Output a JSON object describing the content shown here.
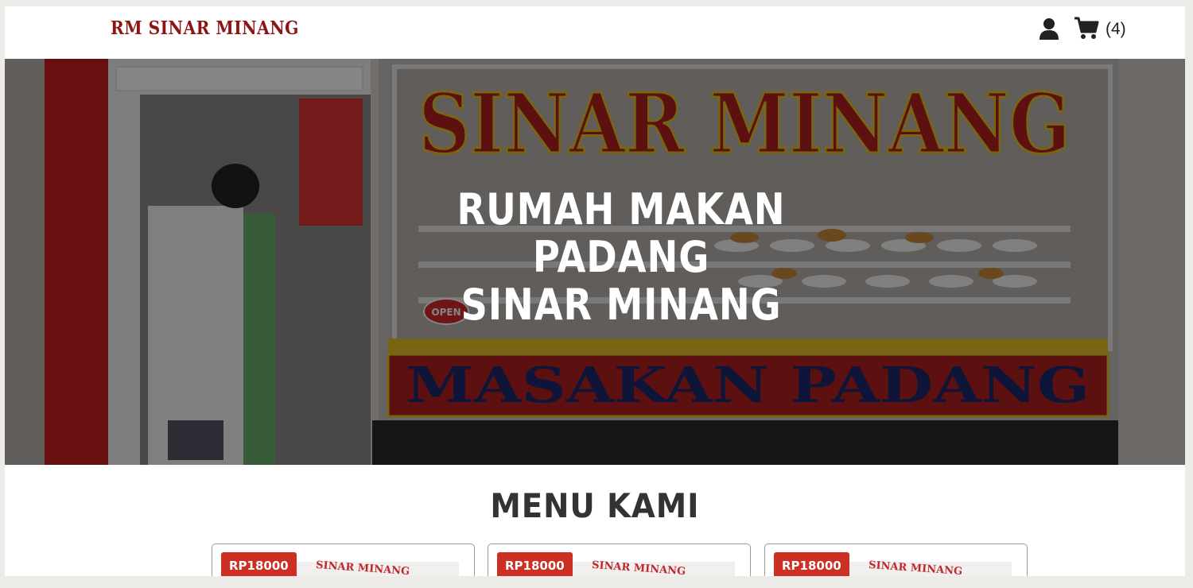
{
  "header": {
    "brand": "RM SINAR MINANG",
    "cart_count": "(4)",
    "icons": [
      "user-icon",
      "cart-icon"
    ]
  },
  "hero": {
    "title_lines": [
      "RUMAH MAKAN",
      "PADANG",
      "SINAR MINANG"
    ],
    "sign_top": "SINAR MINANG",
    "sign_bottom": "MASAKAN PADANG",
    "open_sign": "OPEN"
  },
  "menu": {
    "heading": "MENU KAMI",
    "items": [
      {
        "price": "RP18000",
        "image_logo": "SINAR MINANG"
      },
      {
        "price": "RP18000",
        "image_logo": "SINAR MINANG"
      },
      {
        "price": "RP18000",
        "image_logo": "SINAR MINANG"
      }
    ]
  },
  "colors": {
    "brand": "#8e1414",
    "badge": "#cc2f24",
    "sign_red": "#b0201e",
    "sign_yellow": "#e6c228"
  }
}
